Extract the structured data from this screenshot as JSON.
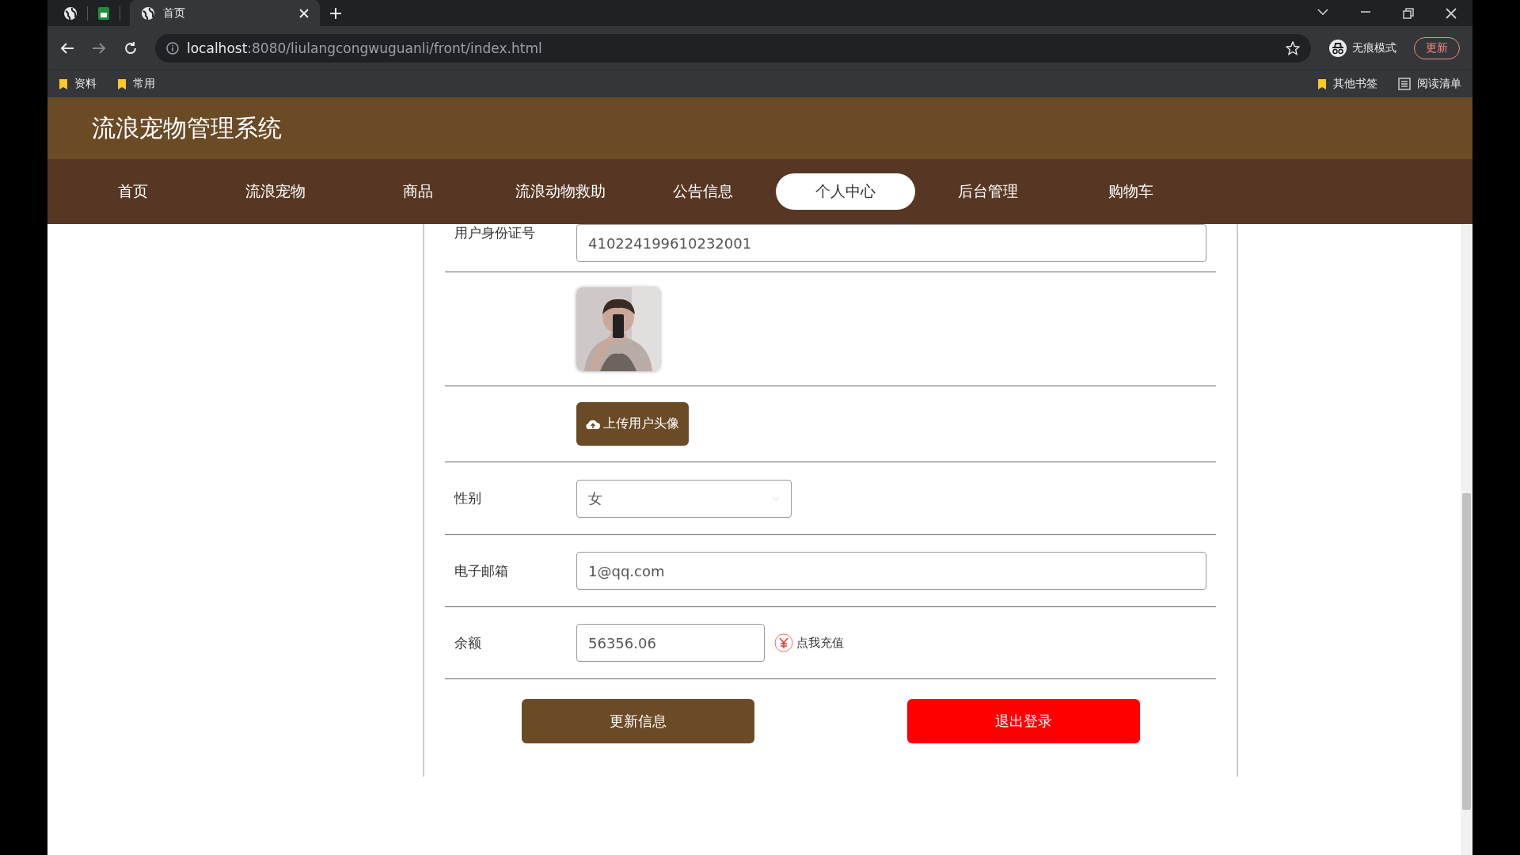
{
  "browser": {
    "tabs": [
      {
        "title": "首页",
        "selected": true
      }
    ],
    "url_host": "localhost",
    "url_path": ":8080/liulangcongwuguanli/front/index.html",
    "profile_label": "无痕模式",
    "update_label": "更新",
    "bookmarks": [
      "资料",
      "常用"
    ],
    "other_bookmarks": "其他书签",
    "reading_list": "阅读清单"
  },
  "site": {
    "title": "流浪宠物管理系统",
    "nav": [
      {
        "label": "首页",
        "selected": false
      },
      {
        "label": "流浪宠物",
        "selected": false
      },
      {
        "label": "商品",
        "selected": false
      },
      {
        "label": "流浪动物救助",
        "selected": false
      },
      {
        "label": "公告信息",
        "selected": false
      },
      {
        "label": "个人中心",
        "selected": true
      },
      {
        "label": "后台管理",
        "selected": false
      },
      {
        "label": "购物车",
        "selected": false
      }
    ]
  },
  "form": {
    "rows": [
      {
        "kind": "text",
        "label": "用户身份证号",
        "value": "410224199610232001"
      },
      {
        "kind": "avatar"
      },
      {
        "kind": "upload",
        "button": "上传用户头像"
      },
      {
        "kind": "select",
        "label": "性别",
        "value": "女"
      },
      {
        "kind": "text",
        "label": "电子邮箱",
        "value": "1@qq.com"
      },
      {
        "kind": "balance",
        "label": "余额",
        "value": "56356.06",
        "recharge": "点我充值"
      }
    ],
    "buttons": [
      {
        "kind": "primary",
        "label": "更新信息"
      },
      {
        "kind": "danger",
        "label": "退出登录"
      }
    ]
  }
}
